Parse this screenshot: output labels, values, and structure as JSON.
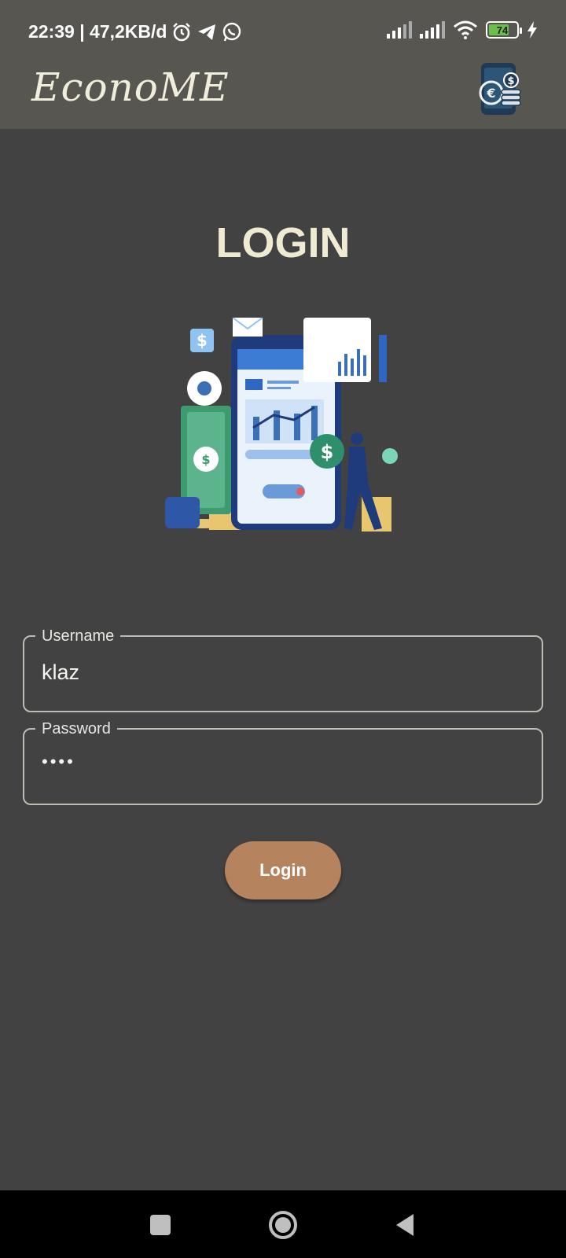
{
  "status_bar": {
    "time_and_speed": "22:39 | 47,2KB/d",
    "battery_level": "74",
    "icons": [
      "alarm-icon",
      "telegram-icon",
      "whatsapp-icon",
      "signal-icon",
      "signal-icon",
      "wifi-icon",
      "battery-icon",
      "charging-icon"
    ]
  },
  "app_bar": {
    "title": "EconoME",
    "logo_icon": "app-logo-icon"
  },
  "page": {
    "title": "LOGIN",
    "illustration": "finance-app-illustration"
  },
  "form": {
    "username": {
      "label": "Username",
      "value": "klaz"
    },
    "password": {
      "label": "Password",
      "value": "••••"
    },
    "submit_label": "Login"
  },
  "colors": {
    "background": "#424242",
    "app_bar": "#575651",
    "title_text": "#efebd3",
    "button": "#b5835e",
    "field_border": "#bdbcb4"
  },
  "nav_bar": {
    "icons": [
      "recent-apps-icon",
      "home-icon",
      "back-icon"
    ]
  }
}
